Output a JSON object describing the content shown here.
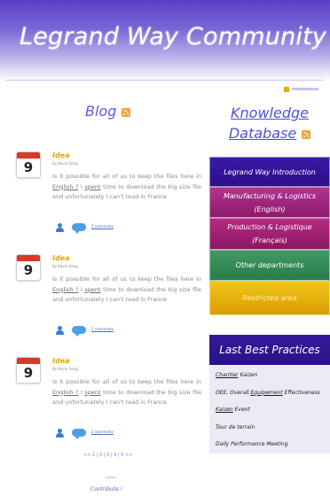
{
  "header": {
    "site_title": "Legrand Way Community"
  },
  "blog": {
    "heading": "Blog",
    "posts": [
      {
        "day": "9",
        "title": "Idea",
        "author": "By Kevin Seng",
        "body_prefix": "Is it possible for all of us to keep the files here in ",
        "body_link1": "English ?",
        "body_sep": " I ",
        "body_link2": "spent",
        "body_suffix": " time to download the big size file and unfortunately I can't read in France",
        "comments": "2 comments"
      },
      {
        "day": "9",
        "title": "Idea",
        "author": "By Kevin Seng",
        "body_prefix": "Is it possible for all of us to keep the files here in ",
        "body_link1": "English ?",
        "body_sep": " I ",
        "body_link2": "spent",
        "body_suffix": " time to download the big size file and unfortunately I can't read in France",
        "comments": "2 comments"
      },
      {
        "day": "9",
        "title": "Idea",
        "author": "By Kevin Seng",
        "body_prefix": "Is it possible for all of us to keep the files here in ",
        "body_link1": "English ?",
        "body_sep": " I ",
        "body_link2": "spent",
        "body_suffix": " time to download the big size file and unfortunately I can't read in France",
        "comments": "2 comments"
      }
    ],
    "pagination": "<< 1 | 2 | 3 | 4 | 5 >>",
    "contribute": "Contribute !"
  },
  "knowledge": {
    "heading_line1": "Knowledge",
    "heading_line2": "Database",
    "buttons": {
      "intro": "Legrand Way Introduction",
      "mfg_line1": "Manufacturing & Logistics",
      "mfg_line2": "(English)",
      "prod_line1": "Production & Logistique",
      "prod_line2": "(Français)",
      "other": "Other departments",
      "restricted": "Restricted area"
    }
  },
  "best_practices": {
    "heading": "Last Best Practices",
    "items": [
      {
        "underlined": "Chantier",
        "rest": " Kaizen"
      },
      {
        "pre": "OEE, Overall ",
        "underlined": "Equipement",
        "rest": " Effectiveness"
      },
      {
        "underlined": "Kaizen",
        "rest": " Event"
      },
      {
        "underlined": "",
        "rest": "Tour de terrain"
      },
      {
        "underlined": "",
        "rest": "Daily Performance Meeting"
      }
    ]
  },
  "colors": {
    "header_gradient_top": "#5a3fc7",
    "blog_heading": "#5b5be6",
    "post_title": "#e2a400",
    "kb_intro": "#2a0f8a",
    "kb_mfg": "#9e2a7f",
    "kb_prod": "#a1237a",
    "kb_other": "#359060",
    "kb_restricted": "#e6b30b",
    "lbp_header": "#2a1386"
  },
  "icons": {
    "rss": "rss-icon",
    "calendar": "calendar-icon",
    "user": "user-icon",
    "comment": "comment-bubble-icon"
  }
}
